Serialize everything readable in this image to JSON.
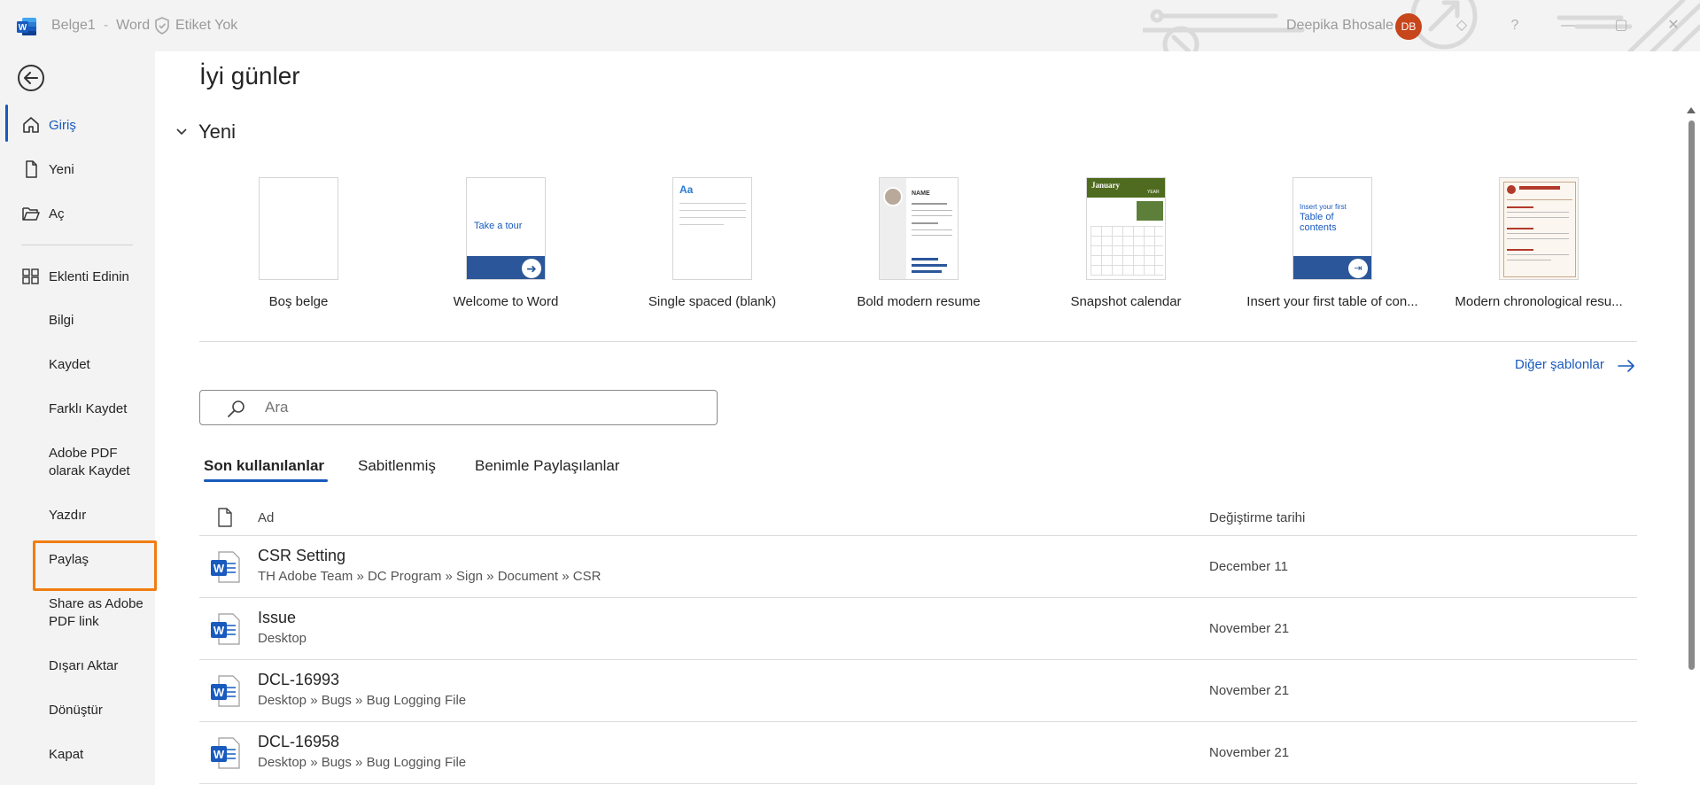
{
  "titlebar": {
    "doc_name": "Belge1",
    "separator": "-",
    "app_name": "Word",
    "sensitivity_label": "Etiket Yok",
    "user_name": "Deepika Bhosale",
    "user_initials": "DB",
    "help": "?",
    "minimize": "—",
    "close": "✕"
  },
  "sidebar": {
    "items": [
      {
        "label": "Giriş",
        "icon": "home-icon"
      },
      {
        "label": "Yeni",
        "icon": "new-document-icon"
      },
      {
        "label": "Aç",
        "icon": "open-folder-icon"
      },
      {
        "label": "Eklenti Edinin",
        "icon": "add-ins-icon"
      }
    ],
    "text_items": [
      {
        "label": "Bilgi"
      },
      {
        "label": "Kaydet"
      },
      {
        "label": "Farklı Kaydet"
      },
      {
        "label": "Adobe PDF olarak Kaydet"
      },
      {
        "label": "Yazdır"
      },
      {
        "label": "Paylaş"
      },
      {
        "label": "Share as Adobe PDF link"
      },
      {
        "label": "Dışarı Aktar"
      },
      {
        "label": "Dönüştür"
      },
      {
        "label": "Kapat"
      }
    ]
  },
  "main": {
    "greeting": "İyi günler",
    "new_section": "Yeni",
    "templates": [
      {
        "name": "Boş belge"
      },
      {
        "name": "Welcome to Word",
        "thumb_text": "Take a tour"
      },
      {
        "name": "Single spaced (blank)",
        "thumb_text": "Aa"
      },
      {
        "name": "Bold modern resume",
        "thumb_text": "NAME"
      },
      {
        "name": "Snapshot calendar",
        "thumb_text": "January",
        "thumb_year": "YEAR"
      },
      {
        "name": "Insert your first table of con...",
        "thumb_text": "Insert your first",
        "thumb_text2": "Table of contents"
      },
      {
        "name": "Modern chronological resu..."
      }
    ],
    "more_templates": "Diğer şablonlar",
    "search_placeholder": "Ara",
    "tabs": [
      "Son kullanılanlar",
      "Sabitlenmiş",
      "Benimle Paylaşılanlar"
    ],
    "columns": {
      "name": "Ad",
      "date": "Değiştirme tarihi"
    },
    "files": [
      {
        "name": "CSR Setting",
        "path": "TH Adobe Team » DC Program » Sign » Document » CSR",
        "date": "December 11"
      },
      {
        "name": "Issue",
        "path": "Desktop",
        "date": "November 21"
      },
      {
        "name": "DCL-16993",
        "path": "Desktop » Bugs » Bug Logging File",
        "date": "November 21"
      },
      {
        "name": "DCL-16958",
        "path": "Desktop » Bugs » Bug Logging File",
        "date": "November 21"
      }
    ]
  },
  "colors": {
    "accent": "#185abd",
    "highlight": "#f07d12",
    "avatar": "#c7461c"
  }
}
